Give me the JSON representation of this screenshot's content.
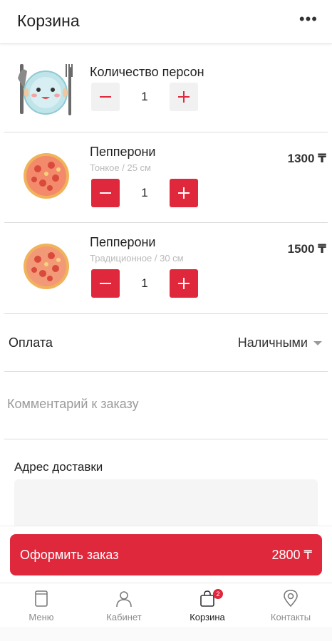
{
  "header": {
    "title": "Корзина",
    "more_icon": "more-horizontal-icon"
  },
  "persons": {
    "label": "Количество персон",
    "quantity": "1",
    "minus": "−",
    "plus": "+"
  },
  "items": [
    {
      "name": "Пепперони",
      "variant": "Тонкое / 25 см",
      "quantity": "1",
      "price": "1300 ₸"
    },
    {
      "name": "Пепперони",
      "variant": "Традиционное / 30 см",
      "quantity": "1",
      "price": "1500 ₸"
    }
  ],
  "payment": {
    "label": "Оплата",
    "value": "Наличными"
  },
  "comment": {
    "placeholder": "Комментарий к заказу"
  },
  "address": {
    "label": "Адрес доставки"
  },
  "checkout": {
    "label": "Оформить заказ",
    "total": "2800 ₸"
  },
  "tabs": [
    {
      "label": "Меню",
      "icon": "menu-page-icon"
    },
    {
      "label": "Кабинет",
      "icon": "user-icon"
    },
    {
      "label": "Корзина",
      "icon": "shopping-bag-icon",
      "badge": "2",
      "active": true
    },
    {
      "label": "Контакты",
      "icon": "location-pin-icon"
    }
  ],
  "colors": {
    "accent": "#e0283c",
    "muted": "#b9b9b9"
  }
}
